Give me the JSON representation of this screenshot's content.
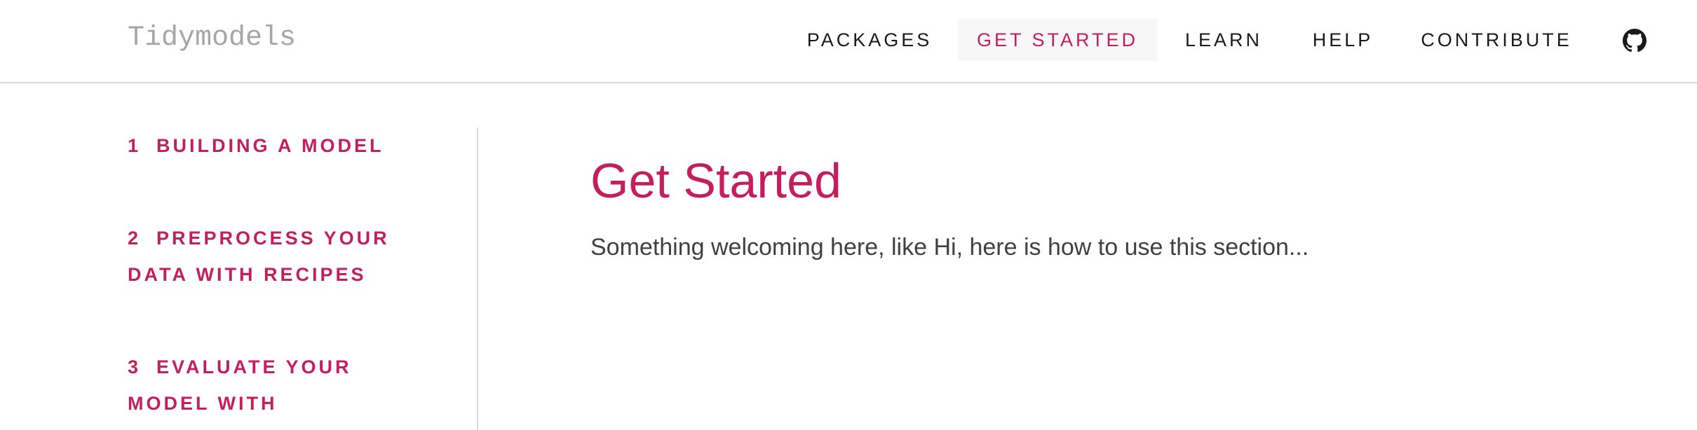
{
  "site": {
    "logo": "Tidymodels"
  },
  "nav": {
    "items": [
      {
        "label": "PACKAGES"
      },
      {
        "label": "GET STARTED",
        "active": true
      },
      {
        "label": "LEARN"
      },
      {
        "label": "HELP"
      },
      {
        "label": "CONTRIBUTE"
      }
    ],
    "github_icon": "github-icon"
  },
  "sidebar": {
    "items": [
      {
        "num": "1",
        "label": "BUILDING A MODEL"
      },
      {
        "num": "2",
        "label": "PREPROCESS YOUR DATA WITH RECIPES"
      },
      {
        "num": "3",
        "label": "EVALUATE YOUR MODEL WITH"
      }
    ]
  },
  "main": {
    "title": "Get Started",
    "intro": "Something welcoming here, like Hi, here is how to use this section..."
  },
  "colors": {
    "accent": "#c41f5a",
    "nav_text": "#1a1a1a",
    "logo": "#a6a6a6"
  }
}
